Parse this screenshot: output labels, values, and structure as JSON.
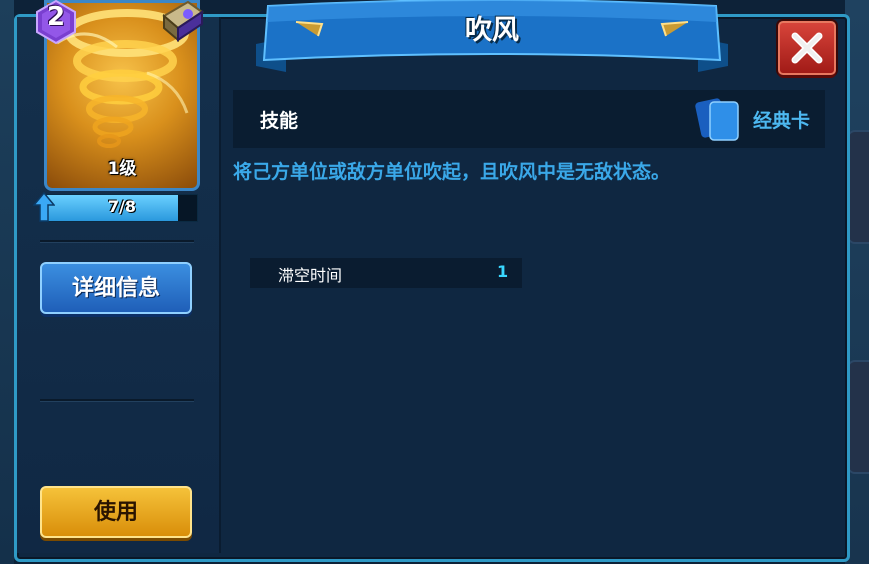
{
  "dialog": {
    "title": "吹风",
    "close_icon": "close-x-icon"
  },
  "card": {
    "cost": "2",
    "level": "1级",
    "art": "whirlwind-tornado",
    "badge_icon": "spellbook-icon"
  },
  "progress": {
    "text": "7/8",
    "current": 7,
    "max": 8
  },
  "buttons": {
    "detail": "详细信息",
    "use": "使用"
  },
  "skill": {
    "label": "技能",
    "card_type": "经典卡",
    "card_type_icon": "card-deck-icon",
    "description": "将己方单位或敌方单位吹起，且吹风中是无敌状态。"
  },
  "stats": [
    {
      "name": "滞空时间",
      "value": "1"
    }
  ],
  "colors": {
    "accent_blue": "#3aa8e8",
    "stat_value": "#39d7ff",
    "gold_button": "#f5c23a",
    "close_red": "#c8322a"
  }
}
